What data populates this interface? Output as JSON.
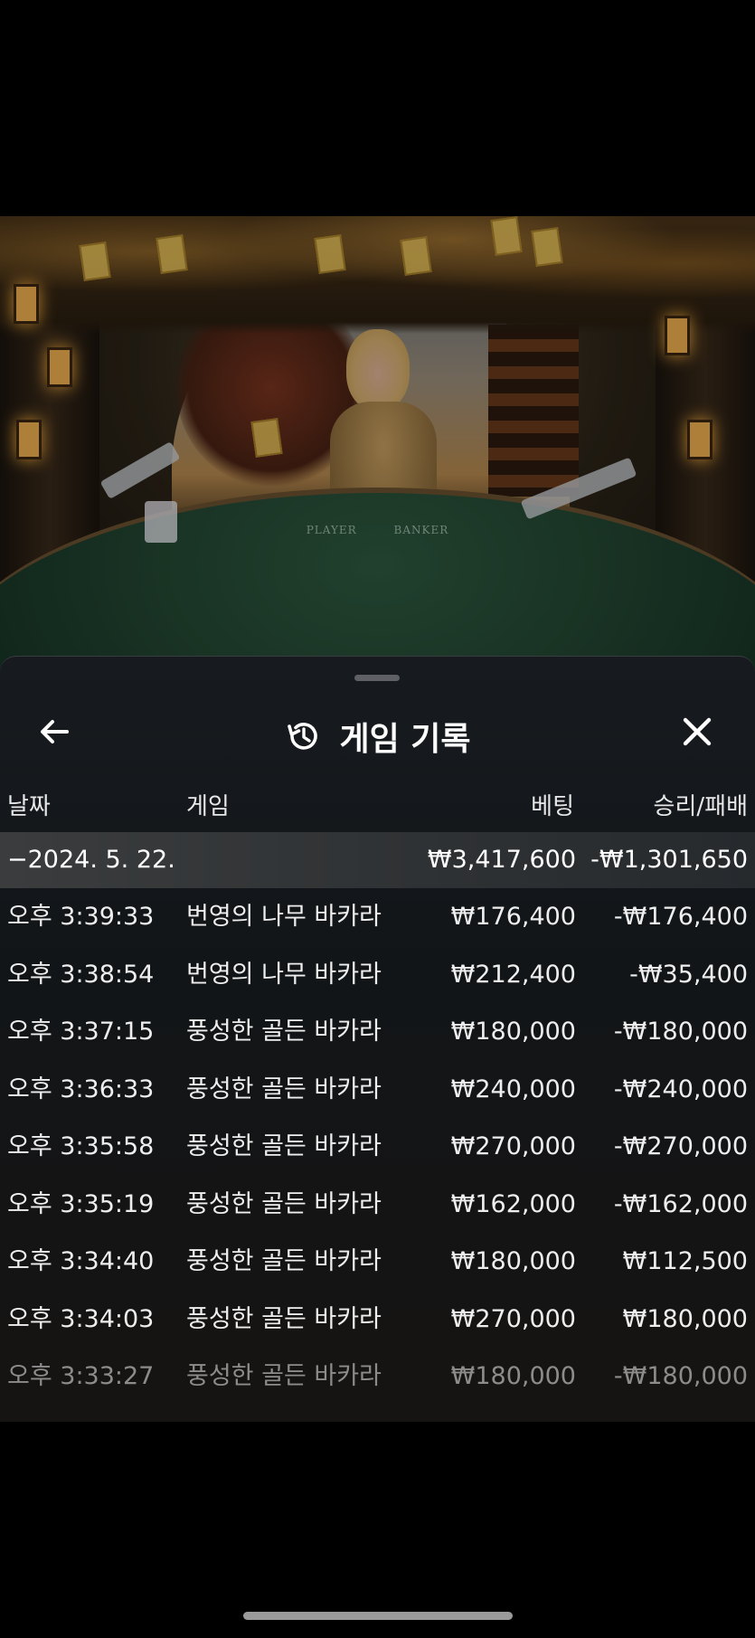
{
  "sheet": {
    "title": "게임 기록",
    "icons": {
      "back": "arrow-left-icon",
      "title": "history-icon",
      "close": "close-icon"
    },
    "columns": {
      "date": "날짜",
      "game": "게임",
      "bet": "베팅",
      "result": "승리/패배"
    },
    "date_group": {
      "label": "−2024. 5. 22.",
      "bet": "₩3,417,600",
      "result": "-₩1,301,650"
    },
    "rows": [
      {
        "time": "오후 3:39:33",
        "game": "번영의 나무 바카라",
        "bet": "₩176,400",
        "result": "-₩176,400"
      },
      {
        "time": "오후 3:38:54",
        "game": "번영의 나무 바카라",
        "bet": "₩212,400",
        "result": "-₩35,400"
      },
      {
        "time": "오후 3:37:15",
        "game": "풍성한 골든 바카라",
        "bet": "₩180,000",
        "result": "-₩180,000"
      },
      {
        "time": "오후 3:36:33",
        "game": "풍성한 골든 바카라",
        "bet": "₩240,000",
        "result": "-₩240,000"
      },
      {
        "time": "오후 3:35:58",
        "game": "풍성한 골든 바카라",
        "bet": "₩270,000",
        "result": "-₩270,000"
      },
      {
        "time": "오후 3:35:19",
        "game": "풍성한 골든 바카라",
        "bet": "₩162,000",
        "result": "-₩162,000"
      },
      {
        "time": "오후 3:34:40",
        "game": "풍성한 골든 바카라",
        "bet": "₩180,000",
        "result": "₩112,500"
      },
      {
        "time": "오후 3:34:03",
        "game": "풍성한 골든 바카라",
        "bet": "₩270,000",
        "result": "₩180,000"
      },
      {
        "time": "오후 3:33:27",
        "game": "풍성한 골든 바카라",
        "bet": "₩180,000",
        "result": "-₩180,000"
      }
    ]
  },
  "video": {
    "table_labels": [
      "PLAYER",
      "BANKER"
    ]
  }
}
